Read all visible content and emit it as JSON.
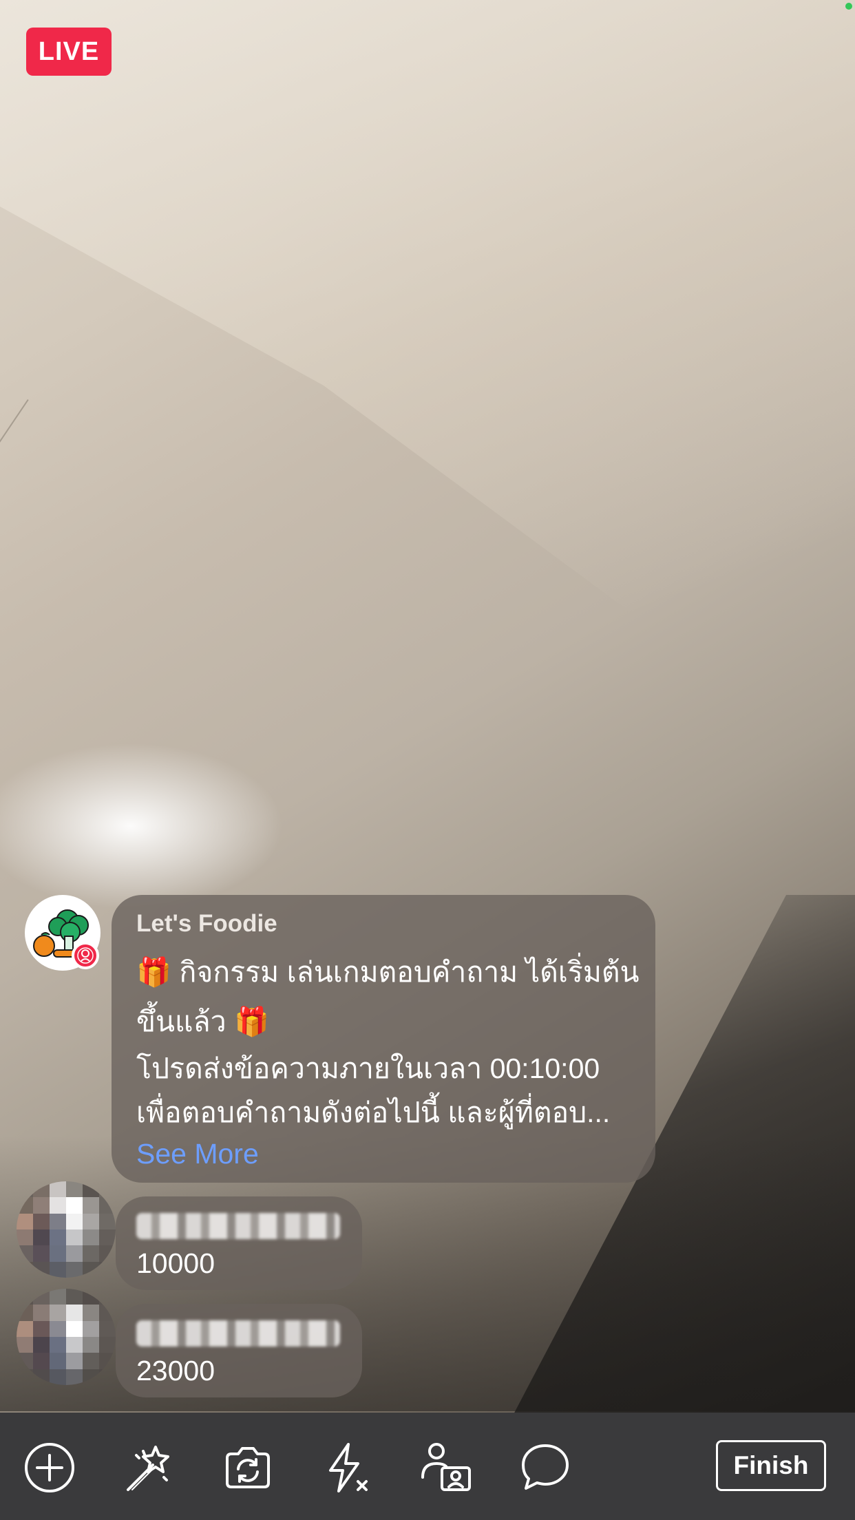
{
  "live_badge": "LIVE",
  "comments": [
    {
      "author": "Let's Foodie",
      "lines": [
        "🎁 กิจกรรม เล่นเกมตอบคำถาม ได้เริ่มต้น",
        "ขึ้นแล้ว 🎁",
        "โปรดส่งข้อความภายในเวลา 00:10:00",
        "เพื่อตอบคำถามดังต่อไปนี้ และผู้ที่ตอบ..."
      ],
      "see_more": "See More",
      "avatar_icon": "broccoli-fruit-icon"
    },
    {
      "author": "",
      "message": "10000"
    },
    {
      "author": "",
      "message": "23000"
    }
  ],
  "toolbar": {
    "items": [
      {
        "name": "add",
        "icon": "plus-circle-icon"
      },
      {
        "name": "effects",
        "icon": "magic-wand-icon"
      },
      {
        "name": "flip-camera",
        "icon": "camera-flip-icon"
      },
      {
        "name": "flash-off",
        "icon": "flash-off-icon"
      },
      {
        "name": "live-with",
        "icon": "add-guest-icon"
      },
      {
        "name": "comments",
        "icon": "comment-bubble-icon"
      }
    ],
    "finish_label": "Finish"
  },
  "colors": {
    "live_red": "#f02849",
    "link_blue": "#6d9eff",
    "toolbar_bg": "#3a3a3c"
  }
}
